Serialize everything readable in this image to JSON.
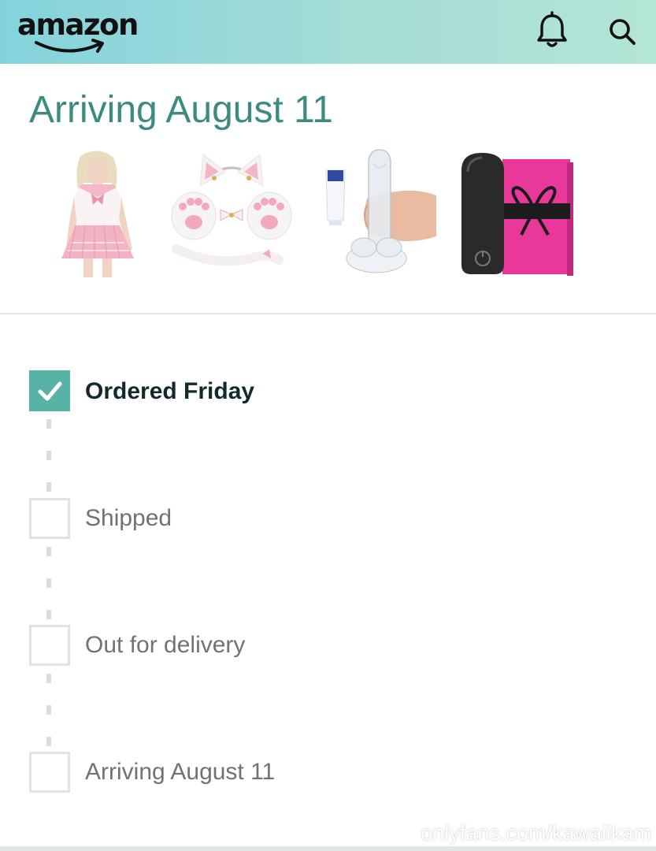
{
  "header": {
    "logo_text": "amazon",
    "gradient_start": "#84d3dc",
    "gradient_end": "#b3e6d6",
    "icons": [
      "bell-icon",
      "search-icon"
    ]
  },
  "shipment": {
    "title": "Arriving August 11",
    "title_color": "#3c8b7f",
    "items": [
      {
        "name": "pink-school-outfit",
        "image": "pink sailor-style schoolgirl outfit"
      },
      {
        "name": "cat-ears-paws-tail-set",
        "image": "white and pink cat ears, paw gloves and tail set"
      },
      {
        "name": "clear-toy-with-lubricant",
        "image": "clear toy with lubricant tube"
      },
      {
        "name": "black-bullet-vibrator-gift-box",
        "image": "black bullet vibrator with pink gift box"
      }
    ]
  },
  "tracker": {
    "accent": "#57b3a6",
    "steps": [
      {
        "label": "Ordered Friday",
        "done": true
      },
      {
        "label": "Shipped",
        "done": false
      },
      {
        "label": "Out for delivery",
        "done": false
      },
      {
        "label": "Arriving August 11",
        "done": false
      }
    ]
  },
  "watermark": "onlyfans.com/kawaiikam"
}
